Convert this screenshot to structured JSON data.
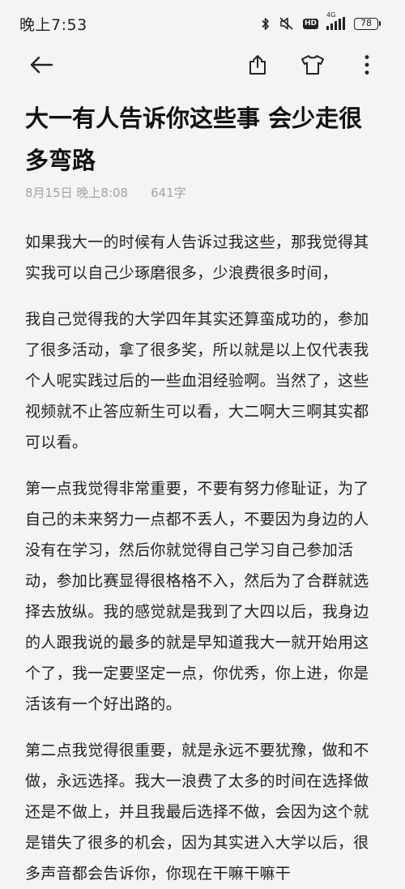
{
  "status_bar": {
    "time": "晚上7:53",
    "network": "4G",
    "hd": "HD",
    "battery": "78"
  },
  "toolbar": {
    "icons": [
      "back-arrow-icon",
      "share-icon",
      "theme-shirt-icon",
      "more-vertical-icon"
    ]
  },
  "note": {
    "title": "大一有人告诉你这些事 会少走很多弯路",
    "date": "8月15日 晚上8:08",
    "word_count": "641字",
    "paragraphs": [
      "如果我大一的时候有人告诉过我这些，那我觉得其实我可以自己少琢磨很多，少浪费很多时间，",
      "我自己觉得我的大学四年其实还算蛮成功的，参加了很多活动，拿了很多奖，所以就是以上仅代表我个人呢实践过后的一些血泪经验啊。当然了，这些视频就不止答应新生可以看，大二啊大三啊其实都可以看。",
      "第一点我觉得非常重要，不要有努力修耻证，为了自己的未来努力一点都不丢人，不要因为身边的人没有在学习，然后你就觉得自己学习自己参加活动，参加比赛显得很格格不入，然后为了合群就选择去放纵。我的感觉就是我到了大四以后，我身边的人跟我说的最多的就是早知道我大一就开始用这个了，我一定要坚定一点，你优秀，你上进，你是活该有一个好出路的。",
      "第二点我觉得很重要，就是永远不要犹豫，做和不做，永远选择。我大一浪费了太多的时间在选择做还是不做上，并且我最后选择不做，会因为这个就是错失了很多的机会，因为其实进入大学以后，很多声音都会告诉你，你现在干嘛干嘛干"
    ]
  }
}
